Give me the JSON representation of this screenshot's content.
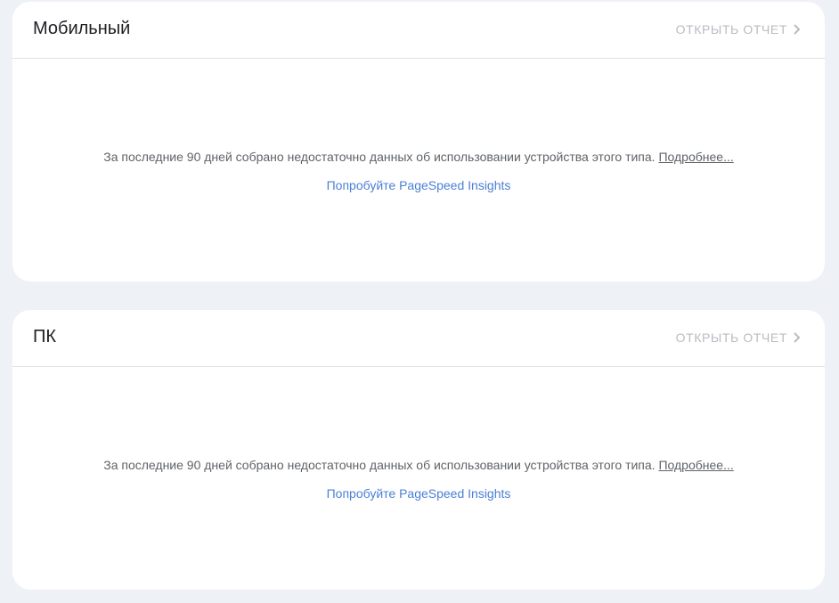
{
  "cards": [
    {
      "title": "Мобильный",
      "open_report_label": "ОТКРЫТЬ ОТЧЕТ",
      "message": "За последние 90 дней собрано недостаточно данных об использовании устройства этого типа.",
      "more_link": "Подробнее...",
      "try_link": "Попробуйте PageSpeed Insights"
    },
    {
      "title": "ПК",
      "open_report_label": "ОТКРЫТЬ ОТЧЕТ",
      "message": "За последние 90 дней собрано недостаточно данных об использовании устройства этого типа.",
      "more_link": "Подробнее...",
      "try_link": "Попробуйте PageSpeed Insights"
    }
  ],
  "icons": {
    "open_report": "chevron-right-icon"
  },
  "colors": {
    "background": "#eef2f7",
    "card": "#ffffff",
    "link": "#4a7fd6",
    "muted": "#b8bcc1"
  }
}
